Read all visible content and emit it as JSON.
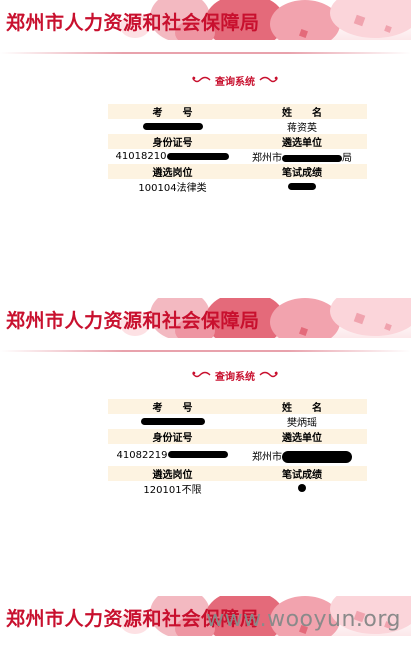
{
  "banner": {
    "title": "郑州市人力资源和社会保障局"
  },
  "query": {
    "title": "查询系统"
  },
  "records": [
    {
      "headers": {
        "exam_no": "考　　号",
        "name": "姓　　名",
        "id_no": "身份证号",
        "unit": "遴选单位",
        "position": "遴选岗位",
        "score": "笔试成绩"
      },
      "values": {
        "exam_no": "",
        "name": "蒋资英",
        "id_no": "41018210",
        "unit": "郑州市",
        "unit_suffix": "局",
        "position": "100104法律类",
        "score": ""
      }
    },
    {
      "headers": {
        "exam_no": "考　　号",
        "name": "姓　　名",
        "id_no": "身份证号",
        "unit": "遴选单位",
        "position": "遴选岗位",
        "score": "笔试成绩"
      },
      "values": {
        "exam_no": "",
        "name": "樊炳瑶",
        "id_no": "41082219",
        "unit": "郑州市",
        "unit_suffix": "",
        "position": "120101不限",
        "score": ""
      }
    }
  ],
  "watermark": "www.wooyun.org",
  "colors": {
    "brand_red": "#c8102e",
    "header_row_bg": "#fdf3e1",
    "redaction": "#000000"
  }
}
